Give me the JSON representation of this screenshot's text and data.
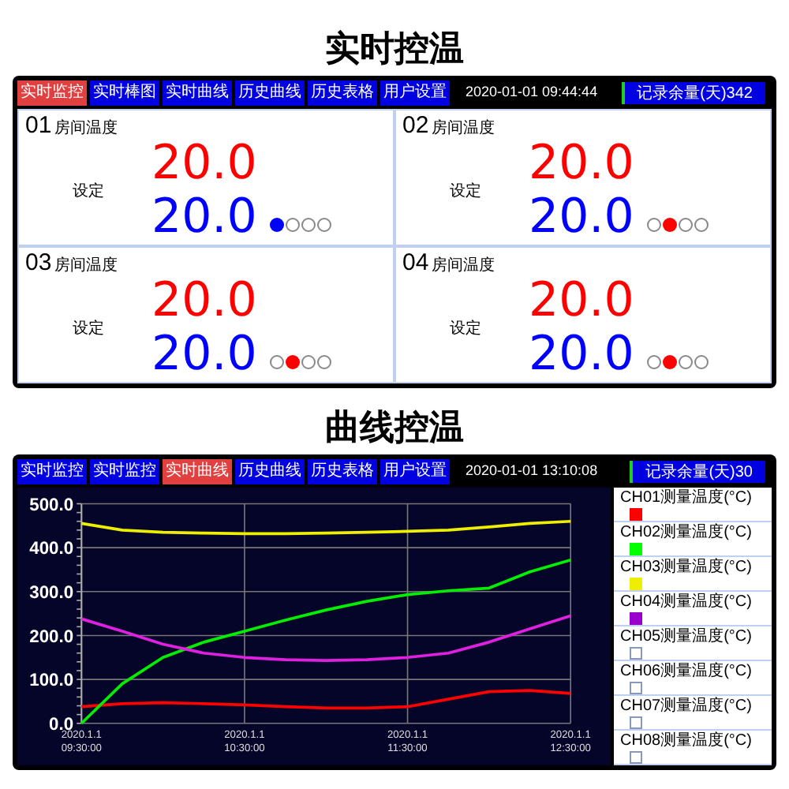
{
  "section_1": {
    "title": "实时控温",
    "tabs": [
      {
        "label": "实时监控",
        "selected": true
      },
      {
        "label": "实时棒图",
        "selected": false
      },
      {
        "label": "实时曲线",
        "selected": false
      },
      {
        "label": "历史曲线",
        "selected": false
      },
      {
        "label": "历史表格",
        "selected": false
      },
      {
        "label": "用户设置",
        "selected": false
      }
    ],
    "datetime": "2020-01-01 09:44:44",
    "record_remaining": "记录余量(天)342",
    "panels": [
      {
        "number": "01",
        "label": "房间温度",
        "value": "20.0",
        "setpoint_label": "设定",
        "setpoint": "20.0",
        "dots": [
          {
            "on": true,
            "color": "#0000ff"
          },
          {
            "on": false
          },
          {
            "on": false
          },
          {
            "on": false
          }
        ]
      },
      {
        "number": "02",
        "label": "房间温度",
        "value": "20.0",
        "setpoint_label": "设定",
        "setpoint": "20.0",
        "dots": [
          {
            "on": false
          },
          {
            "on": true,
            "color": "#ff0000"
          },
          {
            "on": false
          },
          {
            "on": false
          }
        ]
      },
      {
        "number": "03",
        "label": "房间温度",
        "value": "20.0",
        "setpoint_label": "设定",
        "setpoint": "20.0",
        "dots": [
          {
            "on": false
          },
          {
            "on": true,
            "color": "#ff0000"
          },
          {
            "on": false
          },
          {
            "on": false
          }
        ]
      },
      {
        "number": "04",
        "label": "房间温度",
        "value": "20.0",
        "setpoint_label": "设定",
        "setpoint": "20.0",
        "dots": [
          {
            "on": false
          },
          {
            "on": true,
            "color": "#ff0000"
          },
          {
            "on": false
          },
          {
            "on": false
          }
        ]
      }
    ]
  },
  "section_2": {
    "title": "曲线控温",
    "tabs": [
      {
        "label": "实时监控",
        "selected": false
      },
      {
        "label": "实时监控",
        "selected": false
      },
      {
        "label": "实时曲线",
        "selected": true
      },
      {
        "label": "历史曲线",
        "selected": false
      },
      {
        "label": "历史表格",
        "selected": false
      },
      {
        "label": "用户设置",
        "selected": false
      }
    ],
    "datetime": "2020-01-01 13:10:08",
    "record_remaining": "记录余量(天)30",
    "chart_data": {
      "type": "line",
      "grid": true,
      "categories": [
        "2020.1.1\n09:30:00",
        null,
        null,
        null,
        "2020.1.1\n10:30:00",
        null,
        null,
        null,
        "2020.1.1\n11:30:00",
        null,
        null,
        null,
        "2020.1.1\n12:30:00"
      ],
      "ylim": [
        0,
        500
      ],
      "yticks": [
        {
          "value": 0,
          "label": "0.0"
        },
        {
          "value": 100,
          "label": "100.0"
        },
        {
          "value": 200,
          "label": "200.0"
        },
        {
          "value": 300,
          "label": "300.0"
        },
        {
          "value": 400,
          "label": "400.0"
        },
        {
          "value": 500,
          "label": "500.0"
        }
      ],
      "series": [
        {
          "color": "#ff0000",
          "values": [
            38,
            45,
            47,
            45,
            42,
            38,
            35,
            35,
            38,
            55,
            72,
            75,
            68
          ]
        },
        {
          "color": "#00ee00",
          "values": [
            0,
            90,
            150,
            185,
            210,
            235,
            258,
            278,
            293,
            302,
            308,
            345,
            372
          ]
        },
        {
          "color": "#eeee00",
          "values": [
            455,
            440,
            435,
            433,
            432,
            432,
            433,
            435,
            437,
            440,
            447,
            455,
            460
          ]
        },
        {
          "color": "#e020e0",
          "values": [
            238,
            210,
            180,
            160,
            150,
            145,
            143,
            145,
            150,
            160,
            185,
            215,
            245
          ]
        }
      ]
    },
    "legend": [
      {
        "label": "CH01测量温度(°C)",
        "filled": true,
        "color": "#ff0000"
      },
      {
        "label": "CH02测量温度(°C)",
        "filled": true,
        "color": "#00ff00"
      },
      {
        "label": "CH03测量温度(°C)",
        "filled": true,
        "color": "#eeee00"
      },
      {
        "label": "CH04测量温度(°C)",
        "filled": true,
        "color": "#9900cc"
      },
      {
        "label": "CH05测量温度(°C)",
        "filled": false
      },
      {
        "label": "CH06测量温度(°C)",
        "filled": false
      },
      {
        "label": "CH07测量温度(°C)",
        "filled": false
      },
      {
        "label": "CH08测量温度(°C)",
        "filled": false
      }
    ]
  }
}
